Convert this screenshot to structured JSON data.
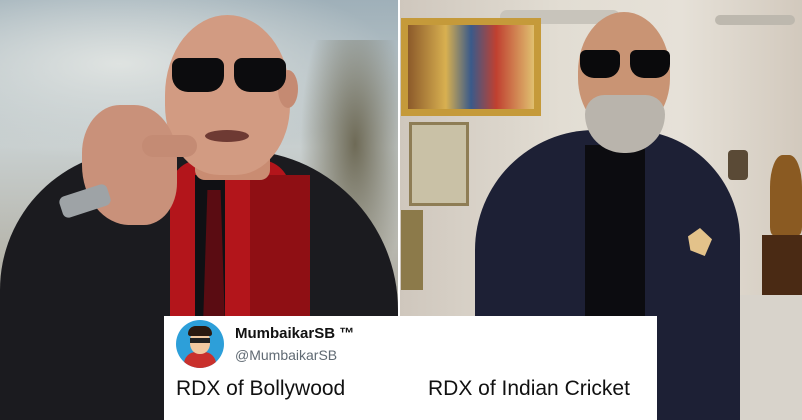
{
  "tweet": {
    "display_name": "MumbaikarSB ™",
    "handle": "@MumbaikarSB",
    "text_left": "RDX of Bollywood",
    "text_right": "RDX of Indian Cricket"
  },
  "colors": {
    "tweet_bg": "#ffffff",
    "name": "#111111",
    "handle": "#606a73",
    "avatar_bg": "#2d9fd9"
  }
}
